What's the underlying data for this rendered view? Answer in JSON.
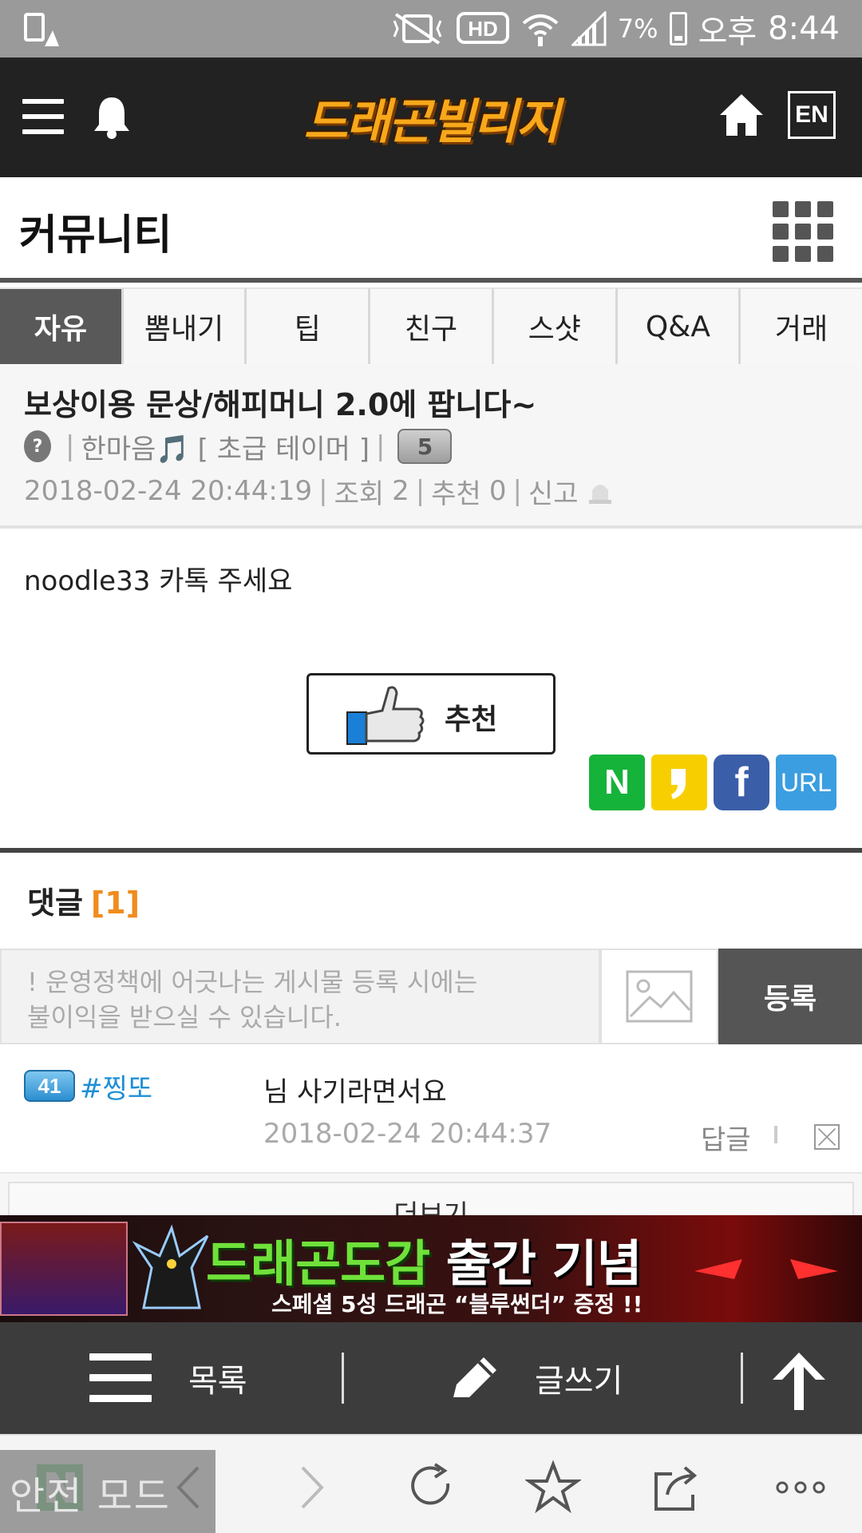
{
  "status_bar": {
    "battery": "7%",
    "ampm": "오후",
    "time": "8:44",
    "icons": [
      "notification-icon",
      "vibrate-off-icon",
      "hd-icon",
      "wifi-icon",
      "signal-icon",
      "battery-icon"
    ]
  },
  "header": {
    "logo_text": "드래곤빌리지",
    "lang_button": "EN"
  },
  "section": {
    "title": "커뮤니티"
  },
  "tabs": [
    {
      "label": "자유",
      "active": true
    },
    {
      "label": "뽐내기"
    },
    {
      "label": "팁"
    },
    {
      "label": "친구"
    },
    {
      "label": "스샷"
    },
    {
      "label": "Q&A"
    },
    {
      "label": "거래"
    }
  ],
  "post": {
    "title": "보상이용 문상/해피머니 2.0에 팝니다~",
    "author_icon": "?",
    "author": "한마음🎵",
    "author_rank": "[ 초급 테이머 ]",
    "level": "5",
    "date": "2018-02-24 20:44:19",
    "views_label": "조회",
    "views": "2",
    "recommend_label": "추천",
    "recommend_count": "0",
    "report_label": "신고",
    "body": "noodle33 카톡 주세요",
    "recommend_button": "추천",
    "share": {
      "naver": "N",
      "facebook": "f",
      "url": "URL"
    }
  },
  "comments": {
    "title": "댓글",
    "count": "[1]",
    "input_placeholder_line1": "! 운영정책에 어긋나는 게시물 등록 시에는",
    "input_placeholder_line2": "불이익을 받으실 수 있습니다.",
    "submit_label": "등록",
    "items": [
      {
        "level": "41",
        "nick": "#찡또",
        "text": "님 사기라면서요",
        "date": "2018-02-24 20:44:37",
        "reply_label": "답글"
      }
    ],
    "more_label": "더보기"
  },
  "banner": {
    "title_green": "드래곤도감",
    "title_white": " 출간 기념",
    "subtitle": "스페셜 5성 드래곤 “블루썬더” 증정 !!"
  },
  "bottom_bar": {
    "list_label": "목록",
    "write_label": "글쓰기"
  },
  "browser": {
    "safe_mode": "안전 모드"
  },
  "colors": {
    "topnav_bg": "#222222",
    "active_tab": "#595959",
    "comment_count": "#f08c1e",
    "nick": "#1e8fd6",
    "bottom_bar_bg": "#3c3c3c"
  }
}
